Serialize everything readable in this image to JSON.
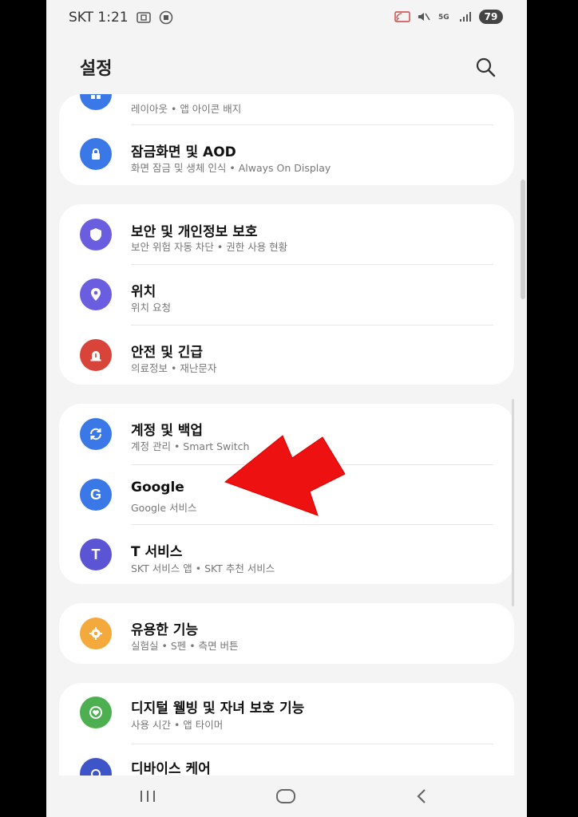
{
  "status_bar": {
    "carrier_time": "SKT 1:21",
    "battery": "79"
  },
  "header": {
    "title": "설정"
  },
  "partial_top": {
    "sub": "레이아웃 • 앱 아이콘 배지"
  },
  "groups": [
    {
      "items": [
        {
          "title": "잠금화면 및 AOD",
          "sub": "화면 잠금 및 생체 인식 • Always On Display"
        }
      ]
    },
    {
      "items": [
        {
          "title": "보안 및 개인정보 보호",
          "sub": "보안 위험 자동 차단 • 권한 사용 현황"
        },
        {
          "title": "위치",
          "sub": "위치 요청"
        },
        {
          "title": "안전 및 긴급",
          "sub": "의료정보 • 재난문자"
        }
      ]
    },
    {
      "items": [
        {
          "title": "계정 및 백업",
          "sub": "계정 관리 • Smart Switch"
        },
        {
          "title": "Google",
          "sub": "Google 서비스"
        },
        {
          "title": "T 서비스",
          "sub": "SKT 서비스 앱 • SKT 추천 서비스"
        }
      ]
    },
    {
      "items": [
        {
          "title": "유용한 기능",
          "sub": "실험실 • S펜 • 측면 버튼"
        }
      ]
    },
    {
      "items": [
        {
          "title": "디지털 웰빙 및 자녀 보호 기능",
          "sub": "사용 시간 • 앱 타이머"
        },
        {
          "title": "디바이스 케어",
          "sub": ""
        }
      ]
    }
  ],
  "colors": {
    "blue": "#3a78e8",
    "purple": "#6a5de0",
    "red": "#d9443a",
    "orange": "#f4a93c",
    "green": "#4caf50",
    "arrow": "#ee1111"
  }
}
